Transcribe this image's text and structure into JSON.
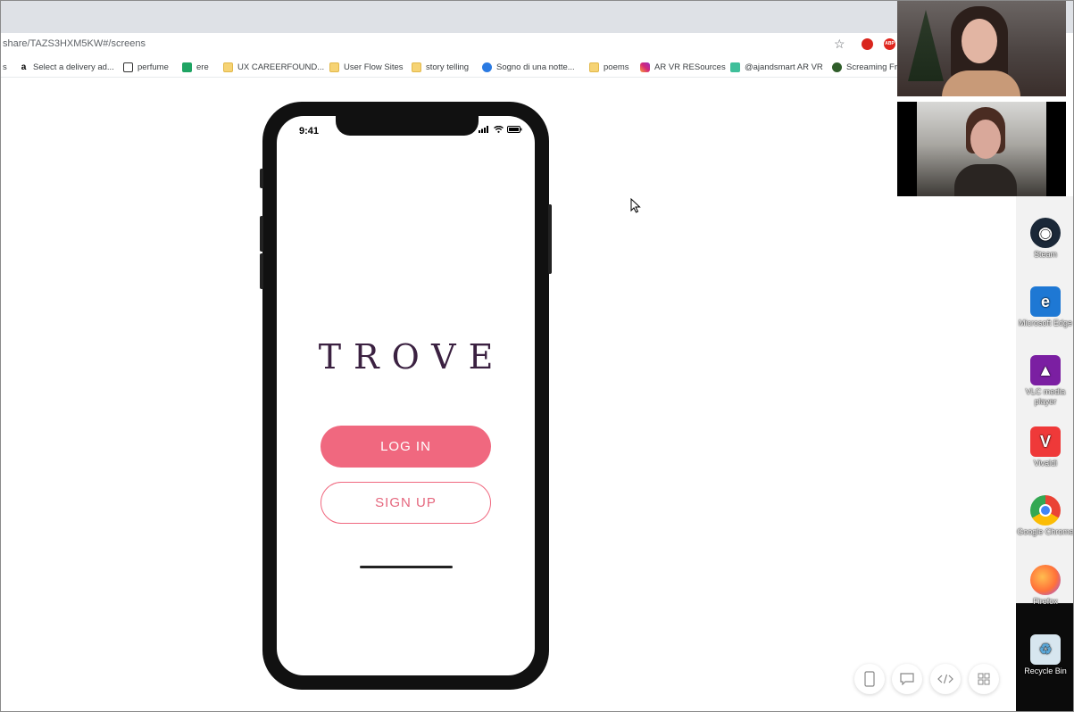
{
  "browser": {
    "url": "share/TAZS3HXM5KW#/screens",
    "bookmarks": [
      {
        "label": "s",
        "icon": "bookmark-icon"
      },
      {
        "label": "Select a delivery ad...",
        "icon": "amazon-icon"
      },
      {
        "label": "perfume",
        "icon": "fragrance-site-icon"
      },
      {
        "label": "ere",
        "icon": "sheets-icon"
      },
      {
        "label": "UX CAREERFOUND...",
        "icon": "folder-icon"
      },
      {
        "label": "User Flow Sites",
        "icon": "folder-icon"
      },
      {
        "label": "story telling",
        "icon": "folder-icon"
      },
      {
        "label": "Sogno di una notte...",
        "icon": "site-icon"
      },
      {
        "label": "poems",
        "icon": "folder-icon"
      },
      {
        "label": "AR VR RESources",
        "icon": "instagram-icon"
      },
      {
        "label": "@ajandsmart AR VR",
        "icon": "site-icon"
      },
      {
        "label": "Screaming Fr",
        "icon": "site-icon"
      }
    ],
    "extension_badge": "ABP"
  },
  "phone": {
    "time": "9:41",
    "logo": "TROVE",
    "login_label": "LOG IN",
    "signup_label": "SIGN UP"
  },
  "desktop_icons": [
    {
      "label": "Steam",
      "color": "#1b2838"
    },
    {
      "label": "Microsoft Edge",
      "color": "#1e78d4"
    },
    {
      "label": "VLC media player",
      "color": "#7b1fa2"
    },
    {
      "label": "Vivaldi",
      "color": "#ef3939"
    },
    {
      "label": "Google Chrome",
      "color": "#4285f4"
    },
    {
      "label": "Firefox",
      "color": "#ff7139"
    },
    {
      "label": "Recycle Bin",
      "color": "#5aa6d6"
    }
  ],
  "colors": {
    "accent": "#f0687f",
    "logo": "#3b2141"
  }
}
